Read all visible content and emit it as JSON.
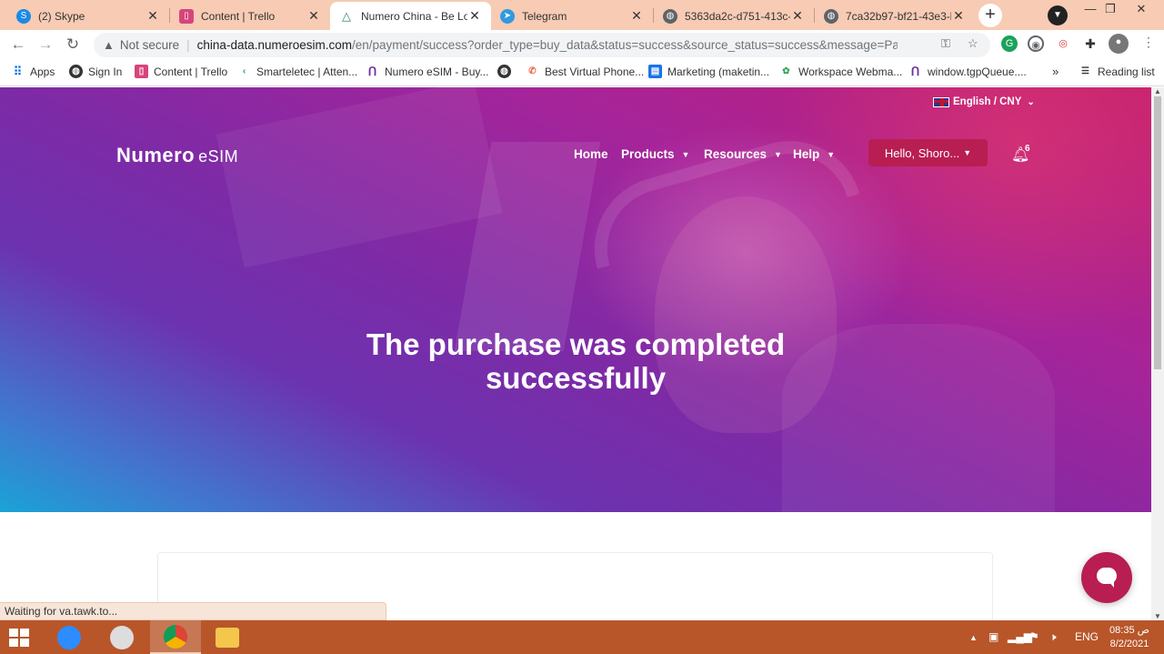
{
  "browser": {
    "tabs": [
      {
        "title": "(2) Skype",
        "icon": "skype-icon",
        "color": "#1a8be8"
      },
      {
        "title": "Content | Trello",
        "icon": "trello-icon",
        "color": "#d6457c"
      },
      {
        "title": "Numero China - Be Loc",
        "icon": "numero-tab-icon",
        "color": "#2f8a77"
      },
      {
        "title": "Telegram",
        "icon": "telegram-icon",
        "color": "#2f9be0"
      },
      {
        "title": "5363da2c-d751-413c-a",
        "icon": "globe-icon",
        "color": "#5f6368"
      },
      {
        "title": "7ca32b97-bf21-43e3-b",
        "icon": "globe-icon",
        "color": "#5f6368"
      }
    ],
    "close_glyph": "✕",
    "new_tab_glyph": "+",
    "address": {
      "security": "Not secure",
      "host": "china-data.numeroesim.com",
      "path": "/en/payment/success?order_type=buy_data&status=success&source_status=success&message=Payment%2..."
    },
    "bookmarks": [
      {
        "label": "Apps"
      },
      {
        "label": "Sign In"
      },
      {
        "label": "Content | Trello"
      },
      {
        "label": "Smarteletec | Atten..."
      },
      {
        "label": "Numero eSIM - Buy..."
      },
      {
        "label": ""
      },
      {
        "label": "Best Virtual Phone..."
      },
      {
        "label": "Marketing (maketin..."
      },
      {
        "label": "Workspace Webma..."
      },
      {
        "label": "window.tgpQueue...."
      }
    ],
    "bookmarks_overflow": "»",
    "reading_list": "Reading list",
    "status_text": "Waiting for va.tawk.to..."
  },
  "site": {
    "language": "English / CNY",
    "logo": {
      "main": "Numero",
      "suffix": "eSIM"
    },
    "nav": [
      {
        "label": "Home",
        "has_menu": false
      },
      {
        "label": "Products",
        "has_menu": true
      },
      {
        "label": "Resources",
        "has_menu": true
      },
      {
        "label": "Help",
        "has_menu": true
      }
    ],
    "account_button": "Hello, Shoro...",
    "notifications_count": "6",
    "headline_line1": "The purchase was completed",
    "headline_line2": "successfully",
    "brand_color": "#b81e52"
  },
  "taskbar": {
    "language": "ENG",
    "time": "08:35 ص",
    "date": "8/2/2021"
  }
}
